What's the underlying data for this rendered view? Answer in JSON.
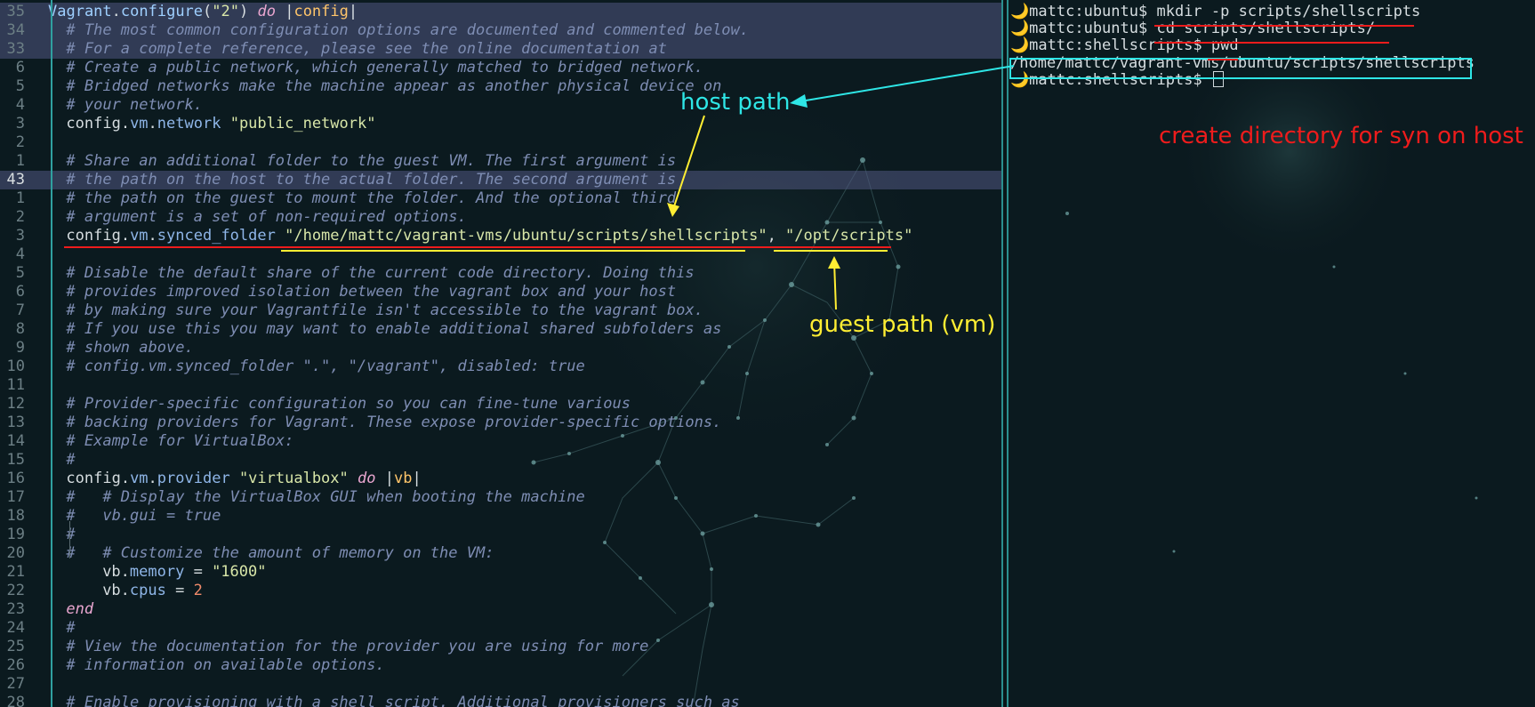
{
  "editor": {
    "lines": [
      {
        "n": "35",
        "hl": true,
        "cur": false,
        "indent": 0,
        "parts": [
          [
            "fn",
            "Vagrant"
          ],
          [
            "txt",
            "."
          ],
          [
            "fn",
            "configure"
          ],
          [
            "txt",
            "("
          ],
          [
            "str",
            "\"2\""
          ],
          [
            "txt",
            ") "
          ],
          [
            "kw",
            "do"
          ],
          [
            "txt",
            " |"
          ],
          [
            "blk",
            "config"
          ],
          [
            "txt",
            "|"
          ]
        ]
      },
      {
        "n": "34",
        "hl": true,
        "cur": false,
        "indent": 1,
        "parts": [
          [
            "cm",
            "# The most common configuration options are documented and commented below."
          ]
        ]
      },
      {
        "n": "33",
        "hl": true,
        "cur": false,
        "indent": 1,
        "parts": [
          [
            "cm",
            "# For a complete reference, please see the online documentation at"
          ]
        ]
      },
      {
        "n": "6",
        "hl": false,
        "cur": false,
        "indent": 1,
        "parts": [
          [
            "cm",
            "# Create a public network, which generally matched to bridged network."
          ]
        ]
      },
      {
        "n": "5",
        "hl": false,
        "cur": false,
        "indent": 1,
        "parts": [
          [
            "cm",
            "# Bridged networks make the machine appear as another physical device on"
          ]
        ]
      },
      {
        "n": "4",
        "hl": false,
        "cur": false,
        "indent": 1,
        "parts": [
          [
            "cm",
            "# your network."
          ]
        ]
      },
      {
        "n": "3",
        "hl": false,
        "cur": false,
        "indent": 1,
        "parts": [
          [
            "txt",
            "config"
          ],
          [
            "txt",
            "."
          ],
          [
            "prop",
            "vm"
          ],
          [
            "txt",
            "."
          ],
          [
            "prop",
            "network"
          ],
          [
            "txt",
            " "
          ],
          [
            "str",
            "\"public_network\""
          ]
        ]
      },
      {
        "n": "2",
        "hl": false,
        "cur": false,
        "indent": 1,
        "parts": []
      },
      {
        "n": "1",
        "hl": false,
        "cur": false,
        "indent": 1,
        "parts": [
          [
            "cm",
            "# Share an additional folder to the guest VM. The first argument is"
          ]
        ]
      },
      {
        "n": "43",
        "hl": true,
        "cur": true,
        "indent": 1,
        "parts": [
          [
            "cm",
            "# the path on the host to the actual folder. The second argument is"
          ]
        ]
      },
      {
        "n": "1",
        "hl": false,
        "cur": false,
        "indent": 1,
        "parts": [
          [
            "cm",
            "# the path on the guest to mount the folder. And the optional third"
          ]
        ]
      },
      {
        "n": "2",
        "hl": false,
        "cur": false,
        "indent": 1,
        "parts": [
          [
            "cm",
            "# argument is a set of non-required options."
          ]
        ]
      },
      {
        "n": "3",
        "hl": false,
        "cur": false,
        "indent": 1,
        "parts": [
          [
            "txt",
            "config"
          ],
          [
            "txt",
            "."
          ],
          [
            "prop",
            "vm"
          ],
          [
            "txt",
            "."
          ],
          [
            "prop",
            "synced_folder"
          ],
          [
            "txt",
            " "
          ],
          [
            "str",
            "\"/home/mattc/vagrant-vms/ubuntu/scripts/shellscripts\""
          ],
          [
            "txt",
            ", "
          ],
          [
            "str",
            "\"/opt/scripts\""
          ]
        ]
      },
      {
        "n": "4",
        "hl": false,
        "cur": false,
        "indent": 1,
        "parts": []
      },
      {
        "n": "5",
        "hl": false,
        "cur": false,
        "indent": 1,
        "parts": [
          [
            "cm",
            "# Disable the default share of the current code directory. Doing this"
          ]
        ]
      },
      {
        "n": "6",
        "hl": false,
        "cur": false,
        "indent": 1,
        "parts": [
          [
            "cm",
            "# provides improved isolation between the vagrant box and your host"
          ]
        ]
      },
      {
        "n": "7",
        "hl": false,
        "cur": false,
        "indent": 1,
        "parts": [
          [
            "cm",
            "# by making sure your Vagrantfile isn't accessible to the vagrant box."
          ]
        ]
      },
      {
        "n": "8",
        "hl": false,
        "cur": false,
        "indent": 1,
        "parts": [
          [
            "cm",
            "# If you use this you may want to enable additional shared subfolders as"
          ]
        ]
      },
      {
        "n": "9",
        "hl": false,
        "cur": false,
        "indent": 1,
        "parts": [
          [
            "cm",
            "# shown above."
          ]
        ]
      },
      {
        "n": "10",
        "hl": false,
        "cur": false,
        "indent": 1,
        "parts": [
          [
            "cm",
            "# config.vm.synced_folder \".\", \"/vagrant\", disabled: true"
          ]
        ]
      },
      {
        "n": "11",
        "hl": false,
        "cur": false,
        "indent": 1,
        "parts": []
      },
      {
        "n": "12",
        "hl": false,
        "cur": false,
        "indent": 1,
        "parts": [
          [
            "cm",
            "# Provider-specific configuration so you can fine-tune various"
          ]
        ]
      },
      {
        "n": "13",
        "hl": false,
        "cur": false,
        "indent": 1,
        "parts": [
          [
            "cm",
            "# backing providers for Vagrant. These expose provider-specific options."
          ]
        ]
      },
      {
        "n": "14",
        "hl": false,
        "cur": false,
        "indent": 1,
        "parts": [
          [
            "cm",
            "# Example for VirtualBox:"
          ]
        ]
      },
      {
        "n": "15",
        "hl": false,
        "cur": false,
        "indent": 1,
        "parts": [
          [
            "cm",
            "#"
          ]
        ]
      },
      {
        "n": "16",
        "hl": false,
        "cur": false,
        "indent": 1,
        "parts": [
          [
            "txt",
            "config"
          ],
          [
            "txt",
            "."
          ],
          [
            "prop",
            "vm"
          ],
          [
            "txt",
            "."
          ],
          [
            "prop",
            "provider"
          ],
          [
            "txt",
            " "
          ],
          [
            "str",
            "\"virtualbox\""
          ],
          [
            "txt",
            " "
          ],
          [
            "kw",
            "do"
          ],
          [
            "txt",
            " |"
          ],
          [
            "blk",
            "vb"
          ],
          [
            "txt",
            "|"
          ]
        ]
      },
      {
        "n": "17",
        "hl": false,
        "cur": false,
        "indent": 1,
        "parts": [
          [
            "cm",
            "#   # Display the VirtualBox GUI when booting the machine"
          ]
        ]
      },
      {
        "n": "18",
        "hl": false,
        "cur": false,
        "indent": 1,
        "parts": [
          [
            "cm",
            "#   vb.gui = true"
          ]
        ]
      },
      {
        "n": "19",
        "hl": false,
        "cur": false,
        "indent": 1,
        "parts": [
          [
            "cm",
            "#"
          ]
        ]
      },
      {
        "n": "20",
        "hl": false,
        "cur": false,
        "indent": 1,
        "parts": [
          [
            "cm",
            "#   # Customize the amount of memory on the VM:"
          ]
        ]
      },
      {
        "n": "21",
        "hl": false,
        "cur": false,
        "indent": 3,
        "parts": [
          [
            "txt",
            "vb"
          ],
          [
            "txt",
            "."
          ],
          [
            "prop",
            "memory"
          ],
          [
            "txt",
            " = "
          ],
          [
            "str",
            "\"1600\""
          ]
        ]
      },
      {
        "n": "22",
        "hl": false,
        "cur": false,
        "indent": 3,
        "parts": [
          [
            "txt",
            "vb"
          ],
          [
            "txt",
            "."
          ],
          [
            "prop",
            "cpus"
          ],
          [
            "txt",
            " = "
          ],
          [
            "num",
            "2"
          ]
        ]
      },
      {
        "n": "23",
        "hl": false,
        "cur": false,
        "indent": 1,
        "parts": [
          [
            "kw",
            "end"
          ]
        ]
      },
      {
        "n": "24",
        "hl": false,
        "cur": false,
        "indent": 1,
        "parts": [
          [
            "cm",
            "#"
          ]
        ]
      },
      {
        "n": "25",
        "hl": false,
        "cur": false,
        "indent": 1,
        "parts": [
          [
            "cm",
            "# View the documentation for the provider you are using for more"
          ]
        ]
      },
      {
        "n": "26",
        "hl": false,
        "cur": false,
        "indent": 1,
        "parts": [
          [
            "cm",
            "# information on available options."
          ]
        ]
      },
      {
        "n": "27",
        "hl": false,
        "cur": false,
        "indent": 1,
        "parts": []
      },
      {
        "n": "28",
        "hl": false,
        "cur": false,
        "indent": 1,
        "parts": [
          [
            "cm",
            "# Enable provisioning with a shell script. Additional provisioners such as"
          ]
        ]
      }
    ]
  },
  "terminal": {
    "lines": [
      {
        "kind": "prompt",
        "prompt": "mattc:ubuntu$",
        "cmd": "mkdir -p scripts/shellscripts"
      },
      {
        "kind": "prompt",
        "prompt": "mattc:ubuntu$",
        "cmd": "cd scripts/shellscripts/"
      },
      {
        "kind": "prompt",
        "prompt": "mattc:shellscripts$",
        "cmd": "pwd"
      },
      {
        "kind": "output",
        "prompt": "",
        "cmd": "/home/mattc/vagrant-vms/ubuntu/scripts/shellscripts"
      },
      {
        "kind": "prompt-cursor",
        "prompt": "mattc:shellscripts$",
        "cmd": ""
      }
    ],
    "moon_icon": "🌙"
  },
  "annotations": {
    "host_path": "host path",
    "guest_path": "guest path (vm)",
    "create_dir": "create directory for syn on host"
  },
  "colors": {
    "annot_cyan": "#2ee6e6",
    "annot_yellow": "#ffee33",
    "annot_red": "#ee1c1c"
  }
}
